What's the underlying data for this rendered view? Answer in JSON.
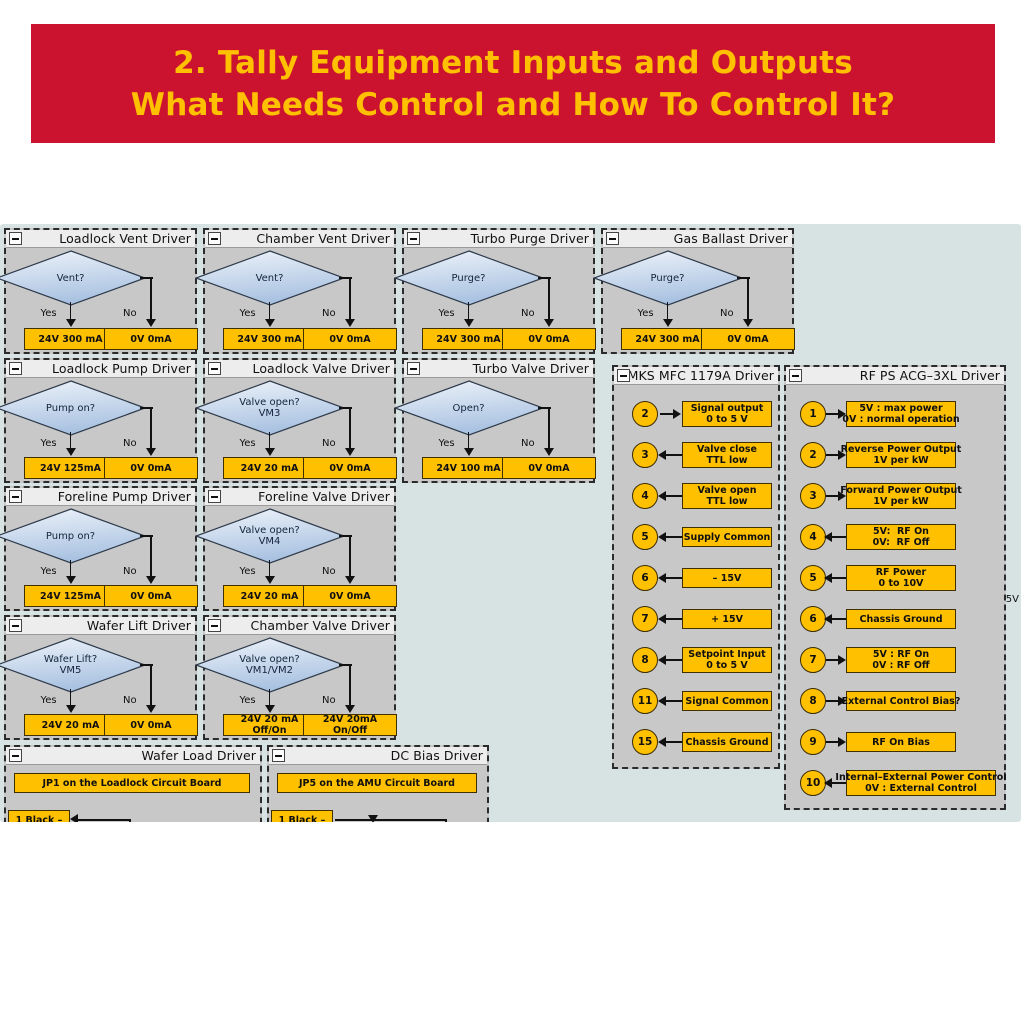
{
  "banner": {
    "line1": "2. Tally Equipment Inputs and Outputs",
    "line2": "What Needs Control and How To Control It?",
    "bg_color": "#cb132f",
    "text_color": "#ffc000"
  },
  "colors": {
    "canvas_bg": "#d7e3e2",
    "panel_bg": "#c8c8c8",
    "panel_header_bg": "#ededed",
    "yellow_box": "#ffc000",
    "diamond_top": "#eef3fa",
    "diamond_bottom": "#a9c2e1"
  },
  "flow_panels": [
    {
      "title": "Loadlock Vent Driver",
      "decision": "Vent?",
      "yes_label": "Yes",
      "no_label": "No",
      "yes_value": "24V 300 mA",
      "no_value": "0V 0mA"
    },
    {
      "title": "Chamber Vent Driver",
      "decision": "Vent?",
      "yes_label": "Yes",
      "no_label": "No",
      "yes_value": "24V 300 mA",
      "no_value": "0V 0mA"
    },
    {
      "title": "Turbo Purge Driver",
      "decision": "Purge?",
      "yes_label": "Yes",
      "no_label": "No",
      "yes_value": "24V 300 mA",
      "no_value": "0V 0mA"
    },
    {
      "title": "Gas Ballast Driver",
      "decision": "Purge?",
      "yes_label": "Yes",
      "no_label": "No",
      "yes_value": "24V 300 mA",
      "no_value": "0V 0mA"
    },
    {
      "title": "Loadlock Pump Driver",
      "decision": "Pump on?",
      "yes_label": "Yes",
      "no_label": "No",
      "yes_value": "24V 125mA",
      "no_value": "0V 0mA"
    },
    {
      "title": "Loadlock Valve Driver",
      "decision": "Valve open?\nVM3",
      "yes_label": "Yes",
      "no_label": "No",
      "yes_value": "24V 20 mA",
      "no_value": "0V 0mA"
    },
    {
      "title": "Turbo Valve Driver",
      "decision": "Open?",
      "yes_label": "Yes",
      "no_label": "No",
      "yes_value": "24V 100 mA",
      "no_value": "0V 0mA"
    },
    {
      "title": "Foreline Pump Driver",
      "decision": "Pump on?",
      "yes_label": "Yes",
      "no_label": "No",
      "yes_value": "24V 125mA",
      "no_value": "0V 0mA"
    },
    {
      "title": "Foreline Valve Driver",
      "decision": "Valve open?\nVM4",
      "yes_label": "Yes",
      "no_label": "No",
      "yes_value": "24V 20 mA",
      "no_value": "0V 0mA"
    },
    {
      "title": "Wafer Lift Driver",
      "decision": "Wafer Lift?\nVM5",
      "yes_label": "Yes",
      "no_label": "No",
      "yes_value": "24V 20 mA",
      "no_value": "0V 0mA"
    },
    {
      "title": "Chamber Valve Driver",
      "decision": "Valve open?\nVM1/VM2",
      "yes_label": "Yes",
      "no_label": "No",
      "yes_value": "24V 20 mA\nOff/On",
      "no_value": "24V 20mA\nOn/Off"
    }
  ],
  "connector_panels": [
    {
      "title": "Wafer Load Driver",
      "header_box": "JP1 on the Loadlock Circuit Board",
      "first_pin": "1 Black –"
    },
    {
      "title": "DC Bias Driver",
      "header_box": "JP5 on the AMU Circuit Board",
      "first_pin": "1 Black –"
    }
  ],
  "mks_panel": {
    "title": "MKS MFC 1179A Driver",
    "pins": [
      {
        "pin": "2",
        "label": "Signal output\n0 to 5 V",
        "direction": "out"
      },
      {
        "pin": "3",
        "label": "Valve close\nTTL low",
        "direction": "in"
      },
      {
        "pin": "4",
        "label": "Valve open\nTTL low",
        "direction": "in"
      },
      {
        "pin": "5",
        "label": "Supply Common",
        "direction": "in"
      },
      {
        "pin": "6",
        "label": "– 15V",
        "direction": "in"
      },
      {
        "pin": "7",
        "label": "+ 15V",
        "direction": "in"
      },
      {
        "pin": "8",
        "label": "Setpoint Input\n0 to 5 V",
        "direction": "in"
      },
      {
        "pin": "11",
        "label": "Signal Common",
        "direction": "in"
      },
      {
        "pin": "15",
        "label": "Chassis Ground",
        "direction": "in"
      }
    ]
  },
  "rf_panel": {
    "title": "RF PS ACG–3XL Driver",
    "pins": [
      {
        "pin": "1",
        "label": "5V : max power\n0V : normal operation",
        "direction": "out"
      },
      {
        "pin": "2",
        "label": "Reverse Power Output\n1V per kW",
        "direction": "out"
      },
      {
        "pin": "3",
        "label": "Forward Power Output\n1V per kW",
        "direction": "out"
      },
      {
        "pin": "4",
        "label": "5V:  RF On\n0V:  RF Off",
        "direction": "in"
      },
      {
        "pin": "5",
        "label": "RF Power\n0 to 10V",
        "direction": "in"
      },
      {
        "pin": "6",
        "label": "Chassis Ground",
        "direction": "in"
      },
      {
        "pin": "7",
        "label": "5V : RF On\n0V : RF Off",
        "direction": "out"
      },
      {
        "pin": "8",
        "label": "External Control Bias?",
        "direction": "out"
      },
      {
        "pin": "9",
        "label": "RF On Bias",
        "direction": "out"
      },
      {
        "pin": "10",
        "label": "Internal–External Power Control\n0V : External Control",
        "direction": "in"
      }
    ]
  },
  "clipped_right_text": "5V"
}
